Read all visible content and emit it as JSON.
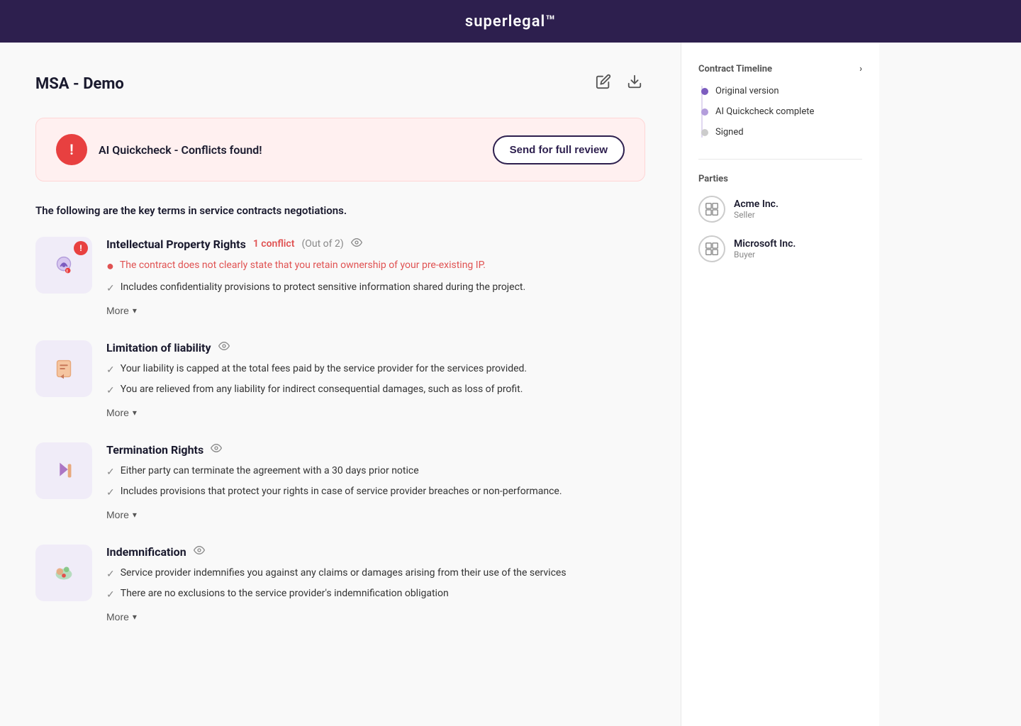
{
  "header": {
    "logo": "superlegal™"
  },
  "page": {
    "title": "MSA - Demo",
    "edit_icon": "✏",
    "download_icon": "⬇"
  },
  "alert": {
    "icon": "!",
    "message": "AI Quickcheck - Conflicts found!",
    "button_label": "Send for full review"
  },
  "intro": {
    "text": "The following are the key terms in service contracts negotiations."
  },
  "terms": [
    {
      "id": "ip",
      "title": "Intellectual Property Rights",
      "conflict_label": "1 conflict",
      "out_of": "(Out of 2)",
      "has_eye": true,
      "conflict_item": "The contract does not clearly state that you retain ownership of your pre-existing IP.",
      "check_items": [
        "Includes confidentiality provisions to protect sensitive information shared during the project."
      ],
      "more_label": "More"
    },
    {
      "id": "liability",
      "title": "Limitation of liability",
      "conflict_label": "",
      "out_of": "",
      "has_eye": true,
      "conflict_item": "",
      "check_items": [
        "Your liability is capped at the total fees paid by the service provider for the services provided.",
        "You are relieved from any liability for indirect consequential damages, such as loss of profit."
      ],
      "more_label": "More"
    },
    {
      "id": "termination",
      "title": "Termination Rights",
      "conflict_label": "",
      "out_of": "",
      "has_eye": true,
      "conflict_item": "",
      "check_items": [
        "Either party can terminate the agreement with a 30 days prior notice",
        "Includes provisions that protect your rights in case of service provider breaches or non-performance."
      ],
      "more_label": "More"
    },
    {
      "id": "indemnification",
      "title": "Indemnification",
      "conflict_label": "",
      "out_of": "",
      "has_eye": true,
      "conflict_item": "",
      "check_items": [
        "Service provider indemnifies you against any claims or damages arising from their use of the services",
        "There are no exclusions to the service provider's indemnification obligation"
      ],
      "more_label": "More"
    }
  ],
  "sidebar": {
    "timeline_title": "Contract Timeline",
    "timeline_chevron": "›",
    "timeline_items": [
      {
        "label": "Original version",
        "dot": "purple"
      },
      {
        "label": "AI Quickcheck complete",
        "dot": "purple-light"
      },
      {
        "label": "Signed",
        "dot": "gray"
      }
    ],
    "parties_title": "Parties",
    "parties": [
      {
        "name": "Acme Inc.",
        "role": "Seller"
      },
      {
        "name": "Microsoft Inc.",
        "role": "Buyer"
      }
    ]
  }
}
